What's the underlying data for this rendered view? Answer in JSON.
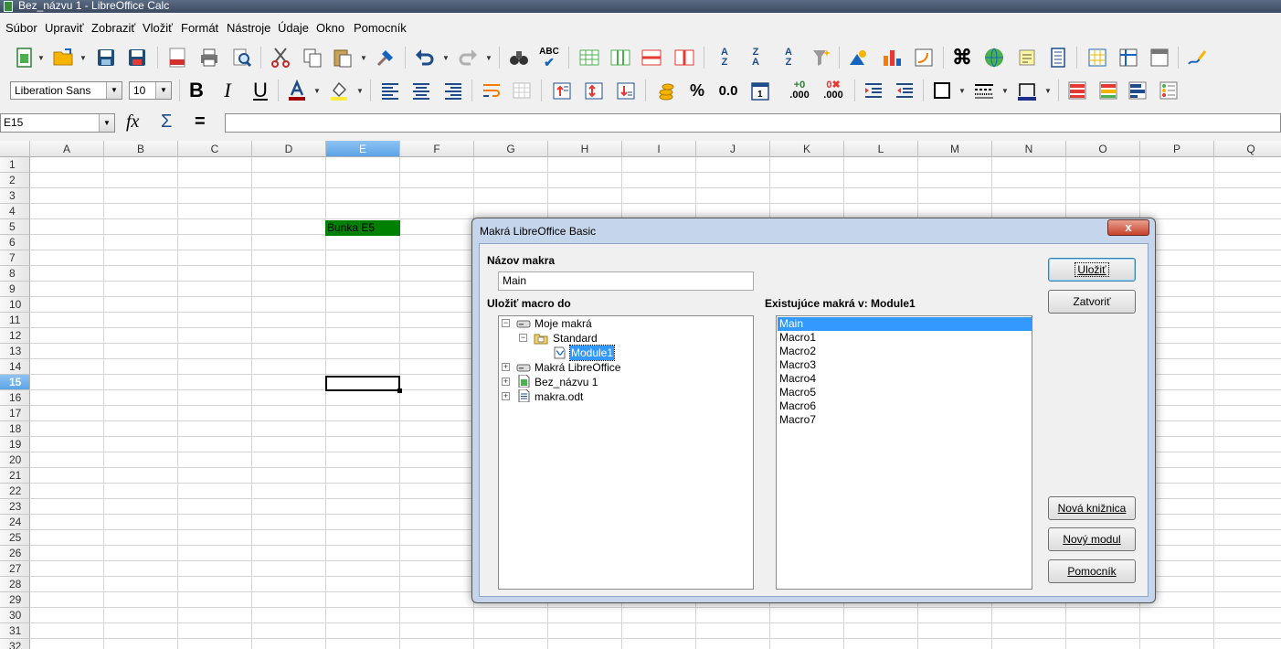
{
  "window": {
    "title": "Bez_názvu 1 - LibreOffice Calc"
  },
  "menu": [
    "Súbor",
    "Upraviť",
    "Zobraziť",
    "Vložiť",
    "Formát",
    "Nástroje",
    "Údaje",
    "Okno",
    "Pomocník"
  ],
  "toolbar": {
    "font_name": "Liberation Sans",
    "font_size": "10",
    "bold": "B",
    "italic": "I",
    "underline": "U",
    "percent": "%",
    "number_format": "0.0",
    "add_decimal": ".000",
    "remove_decimal": ".000",
    "spell_label": "ABC",
    "sort_asc_top": "A",
    "sort_asc_bottom": "Z",
    "sort_desc_top": "Z",
    "sort_desc_bottom": "A"
  },
  "formula_bar": {
    "name_box": "E15",
    "fx": "fx",
    "sum": "Σ",
    "equals": "=",
    "value": ""
  },
  "sheet": {
    "columns": [
      "A",
      "B",
      "C",
      "D",
      "E",
      "F",
      "G",
      "H",
      "I",
      "J",
      "K",
      "L",
      "M",
      "N",
      "O",
      "P",
      "Q"
    ],
    "rows": [
      "1",
      "2",
      "3",
      "4",
      "5",
      "6",
      "7",
      "8",
      "9",
      "10",
      "11",
      "12",
      "13",
      "14",
      "15",
      "16",
      "17",
      "18",
      "19",
      "20",
      "21",
      "22",
      "23",
      "24",
      "25",
      "26",
      "27",
      "28",
      "29",
      "30",
      "31",
      "32"
    ],
    "selected_column": "E",
    "selected_row": "15",
    "cell_e5": {
      "text": "Bunka E5",
      "fill": "#008000"
    }
  },
  "dialog": {
    "title": "Makrá LibreOffice Basic",
    "close": "x",
    "macro_name_label": "Názov makra",
    "macro_name_value": "Main",
    "save_in_label": "Uložiť macro do",
    "existing_label": "Existujúce makrá v: Module1",
    "tree": {
      "my_macros": "Moje makrá",
      "standard": "Standard",
      "module1": "Module1",
      "lo_macros": "Makrá LibreOffice",
      "doc1": "Bez_názvu 1",
      "doc2": "makra.odt"
    },
    "macros": [
      "Main",
      "Macro1",
      "Macro2",
      "Macro3",
      "Macro4",
      "Macro5",
      "Macro6",
      "Macro7"
    ],
    "buttons": {
      "save": "Uložiť",
      "close": "Zatvoriť",
      "new_library": "Nová knižnica",
      "new_module": "Nový modul",
      "help": "Pomocník"
    }
  }
}
